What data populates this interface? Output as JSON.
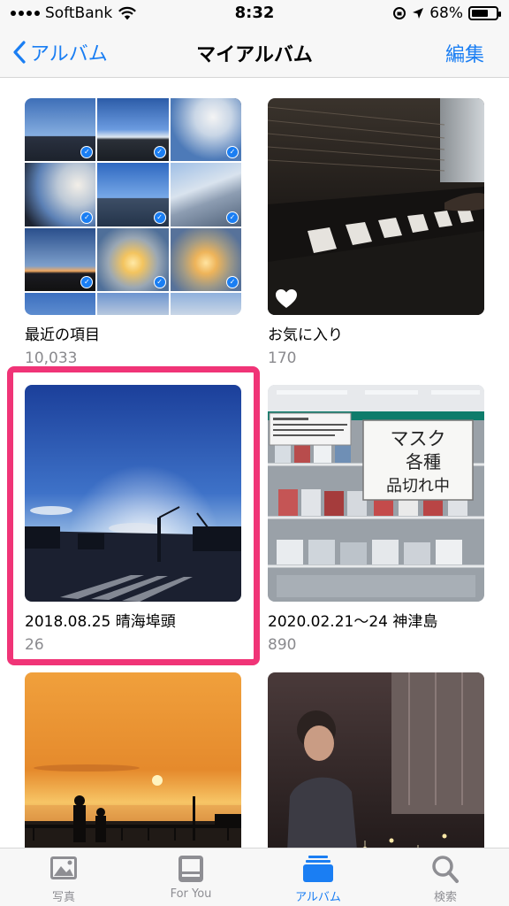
{
  "status_bar": {
    "carrier": "SoftBank",
    "time": "8:32",
    "battery_percent": "68%",
    "battery_level": 0.68
  },
  "nav": {
    "back_label": "アルバム",
    "title": "マイアルバム",
    "edit_label": "編集"
  },
  "albums": [
    {
      "title": "最近の項目",
      "count": "10,033"
    },
    {
      "title": "お気に入り",
      "count": "170"
    },
    {
      "title": "2018.08.25 晴海埠頭",
      "count": "26"
    },
    {
      "title": "2020.02.21〜24 神津島",
      "count": "890"
    }
  ],
  "sign_text": "マスク 各種 品切れ中",
  "tabs": [
    {
      "label": "写真",
      "icon": "photos-icon",
      "active": false
    },
    {
      "label": "For You",
      "icon": "for-you-icon",
      "active": false
    },
    {
      "label": "アルバム",
      "icon": "albums-icon",
      "active": true
    },
    {
      "label": "検索",
      "icon": "search-icon",
      "active": false
    }
  ],
  "colors": {
    "accent": "#1a7ef3",
    "highlight": "#f03477",
    "secondary_text": "#8a8a8e"
  }
}
